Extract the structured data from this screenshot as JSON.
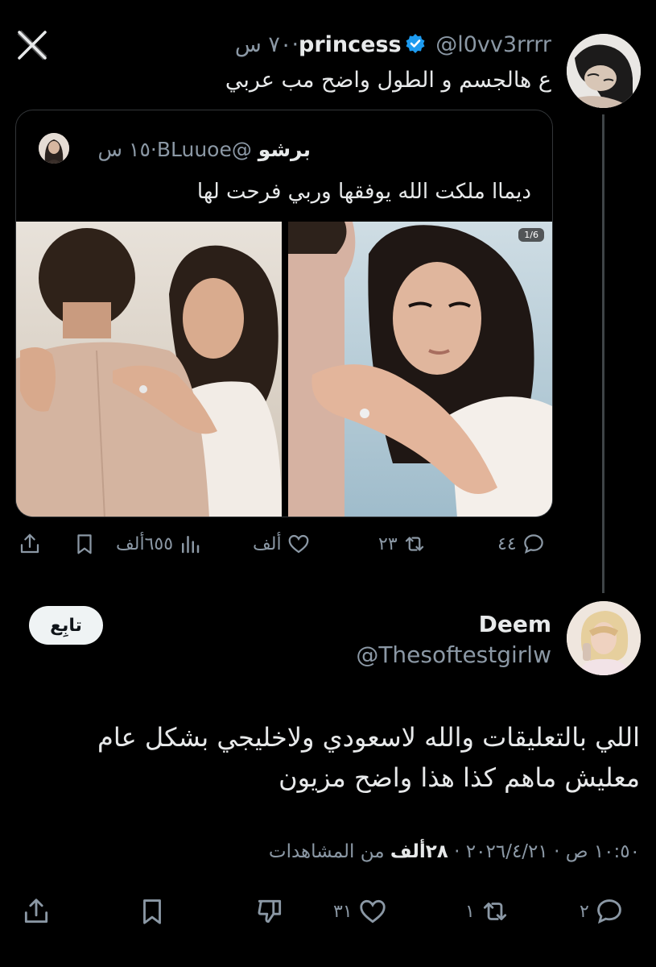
{
  "nav": {
    "close_icon": "x-close-icon"
  },
  "parent_tweet": {
    "author_name": "princess",
    "handle": "@l0vv3rrrr",
    "separator": "·",
    "time": "٧٠ س",
    "text": "ع هالجسم و الطول واضح مب عربي",
    "quote": {
      "author_name": "برشو",
      "handle": "@BLuuoe",
      "separator": "·",
      "time": "١٥ س",
      "text": "ديماا ملكت الله يوفقها وربي فرحت لها",
      "photo_counter": "1/6"
    },
    "actions": {
      "replies": "٤٤",
      "reposts": "٢٣",
      "likes": "ألف",
      "views": "٦٥٥ألف"
    }
  },
  "reply_tweet": {
    "author_name": "Deem",
    "handle": "@Thesoftestgirlw",
    "follow_label": "تابِع",
    "text": "اللي بالتعليقات والله لاسعودي ولاخليجي بشكل عام معليش ماهم كذا هذا واضح مزيون",
    "timestamp": "١٠:٥٠ ص · ٢٠٢٦/٤/٢١",
    "separator": " · ",
    "views_count": "٢٨ألف",
    "views_label": " من المشاهدات",
    "actions": {
      "replies": "٢",
      "reposts": "١",
      "likes": "٣١"
    }
  },
  "colors": {
    "background": "#000000",
    "text": "#e7e9ea",
    "muted": "#8b98a5",
    "verified": "#1d9bf0"
  }
}
